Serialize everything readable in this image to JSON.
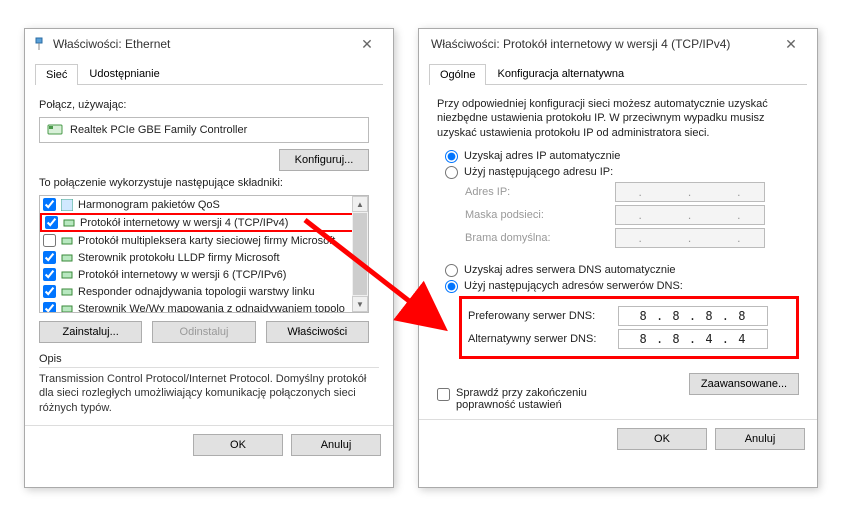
{
  "dlg1": {
    "title": "Właściwości: Ethernet",
    "tabs": {
      "network": "Sieć",
      "sharing": "Udostępnianie"
    },
    "connect_label": "Połącz, używając:",
    "adapter": "Realtek PCIe GBE Family Controller",
    "configure_btn": "Konfiguruj...",
    "list_label": "To połączenie wykorzystuje następujące składniki:",
    "items": {
      "0": "Harmonogram pakietów QoS",
      "1": "Protokół internetowy w wersji 4 (TCP/IPv4)",
      "2": "Protokół multipleksera karty sieciowej firmy Microsoft",
      "3": "Sterownik protokołu LLDP firmy Microsoft",
      "4": "Protokół internetowy w wersji 6 (TCP/IPv6)",
      "5": "Responder odnajdywania topologii warstwy linku",
      "6": "Sterownik We/Wy mapowania z odnajdywaniem topolo"
    },
    "install_btn": "Zainstaluj...",
    "uninstall_btn": "Odinstaluj",
    "properties_btn": "Właściwości",
    "desc_title": "Opis",
    "desc_text": "Transmission Control Protocol/Internet Protocol. Domyślny protokół dla sieci rozległych umożliwiający komunikację połączonych sieci różnych typów.",
    "ok_btn": "OK",
    "cancel_btn": "Anuluj"
  },
  "dlg2": {
    "title": "Właściwości: Protokół internetowy w wersji 4 (TCP/IPv4)",
    "tabs": {
      "general": "Ogólne",
      "alt": "Konfiguracja alternatywna"
    },
    "intro": "Przy odpowiedniej konfiguracji sieci możesz automatycznie uzyskać niezbędne ustawienia protokołu IP. W przeciwnym wypadku musisz uzyskać ustawienia protokołu IP od administratora sieci.",
    "ip_auto": "Uzyskaj adres IP automatycznie",
    "ip_manual": "Użyj następującego adresu IP:",
    "ip_label": "Adres IP:",
    "mask_label": "Maska podsieci:",
    "gw_label": "Brama domyślna:",
    "dns_auto": "Uzyskaj adres serwera DNS automatycznie",
    "dns_manual": "Użyj następujących adresów serwerów DNS:",
    "dns1_label": "Preferowany serwer DNS:",
    "dns2_label": "Alternatywny serwer DNS:",
    "dns1_value": "8  .  8  .  8  .  8",
    "dns2_value": "8  .  8  .  4  .  4",
    "validate_label": "Sprawdź przy zakończeniu poprawność ustawień",
    "advanced_btn": "Zaawansowane...",
    "ok_btn": "OK",
    "cancel_btn": "Anuluj"
  }
}
